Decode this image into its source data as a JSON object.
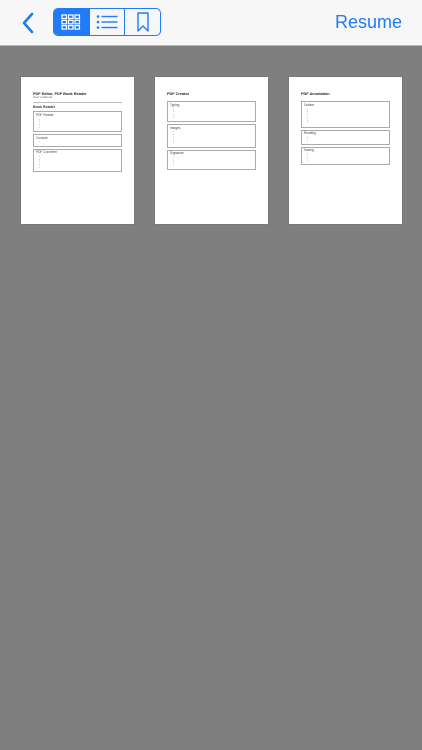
{
  "toolbar": {
    "resume_label": "Resume",
    "view_modes": [
      "grid-view",
      "list-view",
      "bookmark-view"
    ]
  },
  "thumbnails": [
    {
      "title": "PDF Editor, PDF Book Reader",
      "subtitle": "User's Manual",
      "section": "Book Reader",
      "boxes": [
        "PDF Reader",
        "Console",
        "PDF Converter"
      ]
    },
    {
      "title": "PDF Creator",
      "boxes": [
        "Typing",
        "Images",
        "Signature"
      ]
    },
    {
      "title": "PDF Annotation",
      "boxes": [
        "Outline",
        "Reading",
        "Saving"
      ]
    }
  ],
  "colors": {
    "accent": "#1f7cf6",
    "background": "#7f7f7f",
    "navbar": "#f7f7f7"
  }
}
